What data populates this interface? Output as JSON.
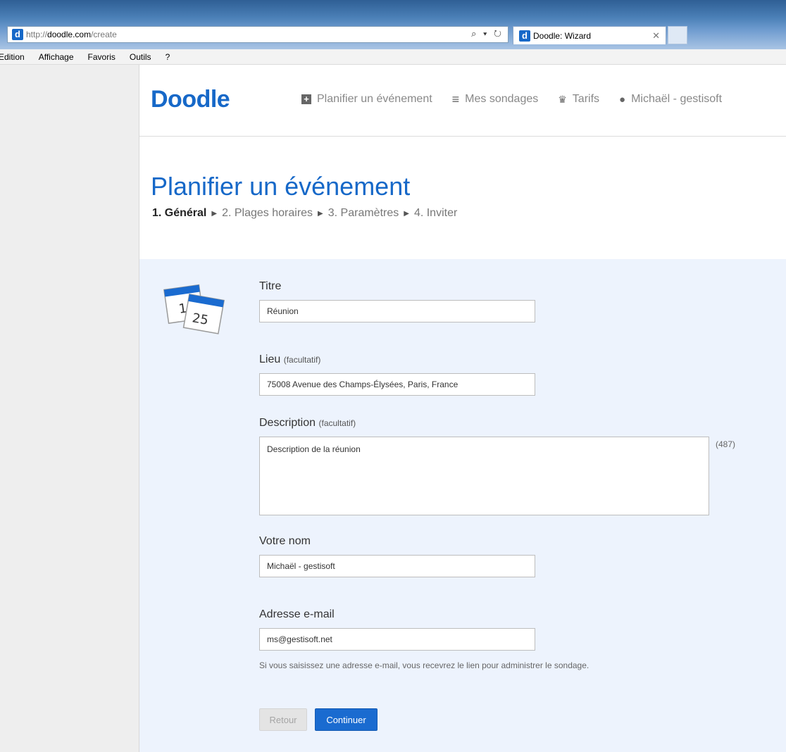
{
  "browser": {
    "url_prefix": "http://",
    "url_host": "doodle.com",
    "url_path": "/create",
    "tab_title": "Doodle: Wizard",
    "addr_actions": "⌕ ▾ ↻",
    "tab_close": "✕",
    "menu": [
      "Edition",
      "Affichage",
      "Favoris",
      "Outils",
      "?"
    ]
  },
  "brand": {
    "logo_text": "Doodle",
    "favicon_letter": "d"
  },
  "nav": [
    {
      "icon": "plus-square-icon",
      "label": "Planifier un événement"
    },
    {
      "icon": "list-icon",
      "label": "Mes sondages"
    },
    {
      "icon": "crown-icon",
      "label": "Tarifs"
    },
    {
      "icon": "user-icon",
      "label": "Michaël - gestisoft"
    }
  ],
  "page": {
    "title": "Planifier un événement"
  },
  "steps": [
    {
      "label": "1. Général",
      "active": true
    },
    {
      "label": "2. Plages horaires"
    },
    {
      "label": "3. Paramètres"
    },
    {
      "label": "4. Inviter"
    }
  ],
  "calendar_icon": {
    "day1": "1",
    "day2": "25"
  },
  "form": {
    "title": {
      "label": "Titre",
      "value": "Réunion"
    },
    "location": {
      "label": "Lieu",
      "optional": "(facultatif)",
      "value": "75008 Avenue des Champs-Élysées, Paris, France"
    },
    "description": {
      "label": "Description",
      "optional": "(facultatif)",
      "value": "Description de la réunion",
      "counter": "(487)"
    },
    "name": {
      "label": "Votre nom",
      "value": "Michaël - gestisoft"
    },
    "email": {
      "label": "Adresse e-mail",
      "value": "ms@gestisoft.net",
      "hint": "Si vous saisissez une adresse e-mail, vous recevrez le lien pour administrer le sondage."
    },
    "back_label": "Retour",
    "continue_label": "Continuer"
  },
  "colors": {
    "accent": "#1668c8",
    "form_background": "#edf3fd",
    "titlebar": "#4a7fb6"
  }
}
